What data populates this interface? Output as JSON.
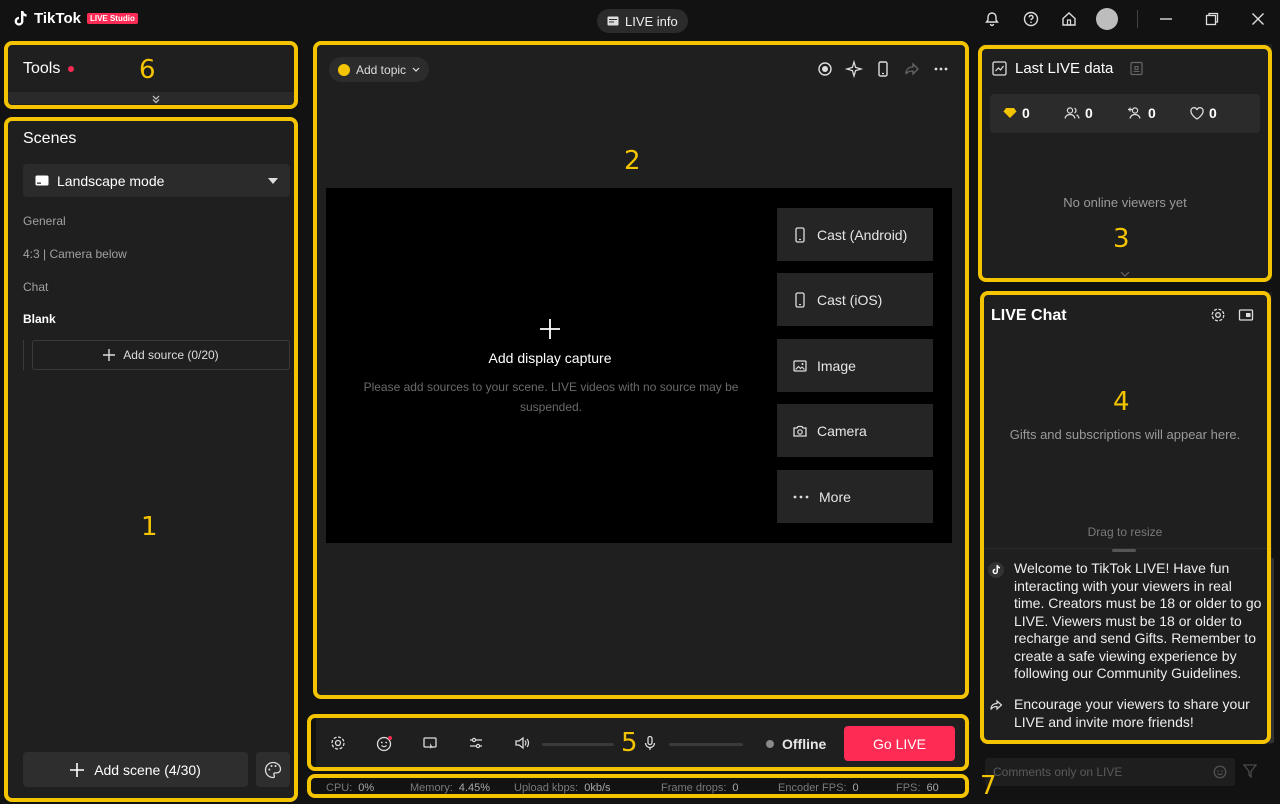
{
  "app": {
    "logo_text": "TikTok",
    "logo_badge": "LIVE Studio",
    "live_info_label": "LIVE info"
  },
  "tools": {
    "title": "Tools"
  },
  "scenes": {
    "title": "Scenes",
    "mode": "Landscape mode",
    "items": [
      "General",
      "4:3 | Camera below",
      "Chat",
      "Blank"
    ],
    "active_index": 3,
    "add_source_label": "Add source (0/20)",
    "add_scene_label": "Add scene (4/30)"
  },
  "preview": {
    "topic_label": "Add topic",
    "add_display_label": "Add display capture",
    "hint": "Please add sources to your scene. LIVE videos with no source may be suspended.",
    "sources": [
      "Cast (Android)",
      "Cast (iOS)",
      "Image",
      "Camera",
      "More"
    ]
  },
  "controls": {
    "status": "Offline",
    "go_live_label": "Go LIVE"
  },
  "stats": {
    "cpu_label": "CPU:",
    "cpu": "0%",
    "memory_label": "Memory:",
    "memory": "4.45%",
    "upload_label": "Upload kbps:",
    "upload": "0kb/s",
    "drops_label": "Frame drops:",
    "drops": "0",
    "encoder_label": "Encoder FPS:",
    "encoder": "0",
    "fps_label": "FPS:",
    "fps": "60"
  },
  "last_live": {
    "title": "Last LIVE data",
    "diamonds": "0",
    "viewers": "0",
    "followers": "0",
    "likes": "0",
    "no_viewers": "No online viewers yet"
  },
  "chat": {
    "title": "LIVE Chat",
    "gifts_text": "Gifts and subscriptions will appear here.",
    "drag_text": "Drag to resize",
    "messages": [
      "Welcome to TikTok LIVE! Have fun interacting with your viewers in real time. Creators must be 18 or older to go LIVE. Viewers must be 18 or older to recharge and send Gifts. Remember to create a safe viewing experience by following our Community Guidelines.",
      "Encourage your viewers to share your LIVE and invite more friends!"
    ],
    "comment_placeholder": "Comments only on LIVE"
  },
  "annotations": [
    "1",
    "2",
    "3",
    "4",
    "5",
    "6",
    "7"
  ],
  "colors": {
    "accent": "#fe2c55",
    "highlight": "#f5c400",
    "panel": "#1f1f1f",
    "background": "#121212"
  }
}
